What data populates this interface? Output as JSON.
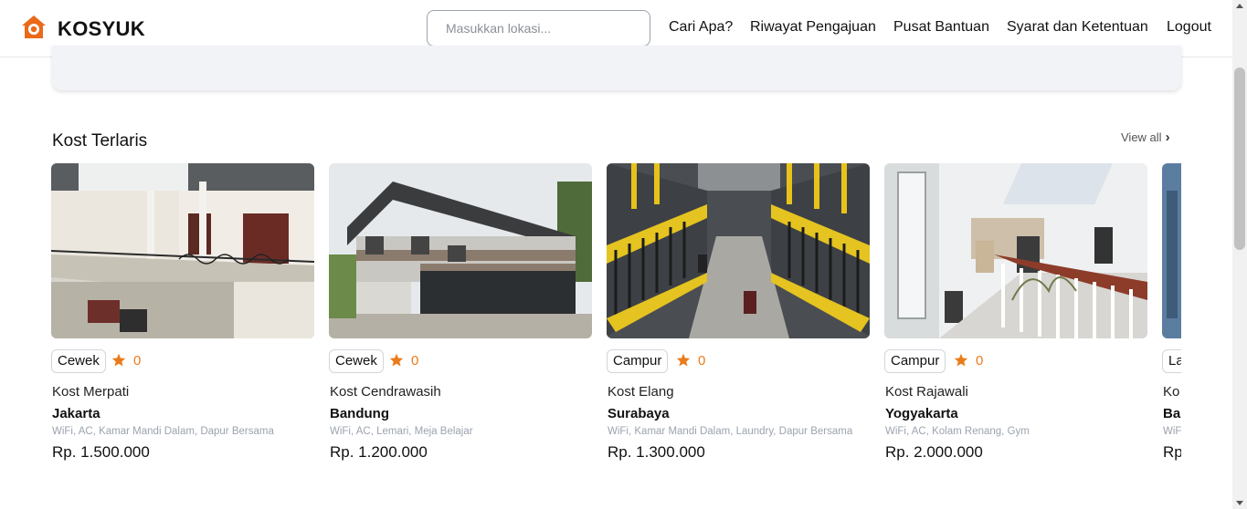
{
  "app": {
    "brand": "KOSYUK",
    "logo_icon": "house-logo-icon",
    "accent": "#ea6a1a"
  },
  "search": {
    "placeholder": "Masukkan lokasi..."
  },
  "nav": {
    "items": [
      {
        "label": "Cari Apa?"
      },
      {
        "label": "Riwayat Pengajuan"
      },
      {
        "label": "Pusat Bantuan"
      },
      {
        "label": "Syarat dan Ketentuan"
      },
      {
        "label": "Logout"
      }
    ]
  },
  "section": {
    "title": "Kost Terlaris",
    "view_all": "View all",
    "view_all_icon": "chevron-right-icon"
  },
  "cards": [
    {
      "type": "Cewek",
      "rating": "0",
      "name": "Kost Merpati",
      "city": "Jakarta",
      "facilities": "WiFi, AC, Kamar Mandi Dalam, Dapur Bersama",
      "price": "Rp. 1.500.000"
    },
    {
      "type": "Cewek",
      "rating": "0",
      "name": "Kost Cendrawasih",
      "city": "Bandung",
      "facilities": "WiFi, AC, Lemari, Meja Belajar",
      "price": "Rp. 1.200.000"
    },
    {
      "type": "Campur",
      "rating": "0",
      "name": "Kost Elang",
      "city": "Surabaya",
      "facilities": "WiFi, Kamar Mandi Dalam, Laundry, Dapur Bersama",
      "price": "Rp. 1.300.000"
    },
    {
      "type": "Campur",
      "rating": "0",
      "name": "Kost Rajawali",
      "city": "Yogyakarta",
      "facilities": "WiFi, AC, Kolam Renang, Gym",
      "price": "Rp. 2.000.000"
    },
    {
      "type": "La",
      "rating": "",
      "name": "Ko",
      "city": "Bal",
      "facilities": "WiF",
      "price": "Rp"
    }
  ],
  "colors": {
    "star": "#ea7b1a",
    "border": "#d1d5db",
    "muted": "#9ca3af"
  }
}
